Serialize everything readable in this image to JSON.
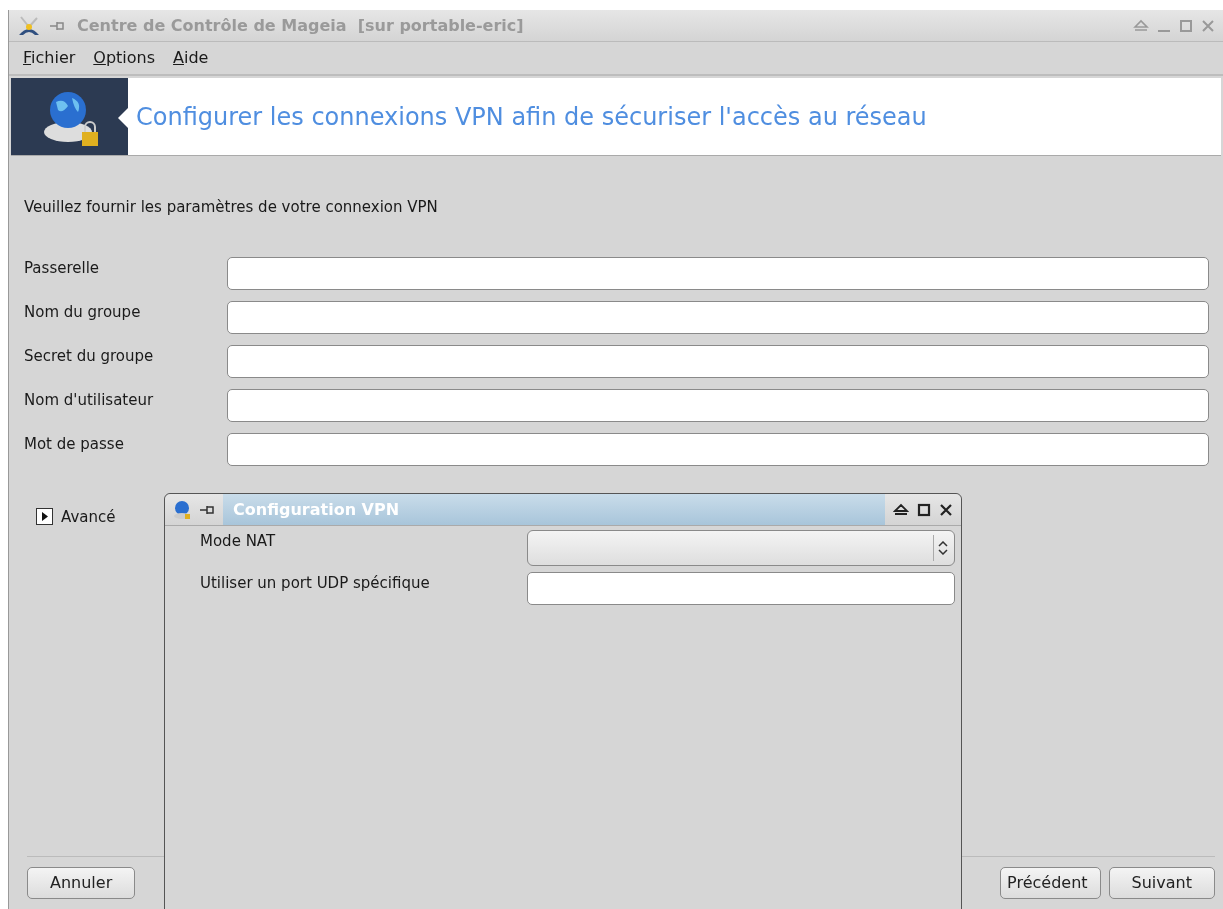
{
  "window": {
    "title": "Centre de Contrôle de Mageia  [sur portable-eric]"
  },
  "menu": [
    {
      "label": "Fichier"
    },
    {
      "label": "Options"
    },
    {
      "label": "Aide"
    }
  ],
  "banner": {
    "title": "Configurer les connexions VPN afin de sécuriser l'accès au réseau"
  },
  "intro": "Veuillez fournir les paramètres de votre connexion VPN",
  "fields": [
    {
      "label": "Passerelle"
    },
    {
      "label": "Nom du groupe"
    },
    {
      "label": "Secret du groupe"
    },
    {
      "label": "Nom d'utilisateur"
    },
    {
      "label": "Mot de passe"
    }
  ],
  "advanced": {
    "label": "Avancé",
    "expanded": false
  },
  "buttons": {
    "cancel": "Annuler",
    "previous": "Précédent",
    "next": "Suivant"
  },
  "dialog": {
    "title": "Configuration VPN",
    "rows": [
      {
        "kind": "select",
        "label": "Mode NAT"
      },
      {
        "kind": "input",
        "label": "Utiliser un port UDP spécifique"
      }
    ]
  }
}
